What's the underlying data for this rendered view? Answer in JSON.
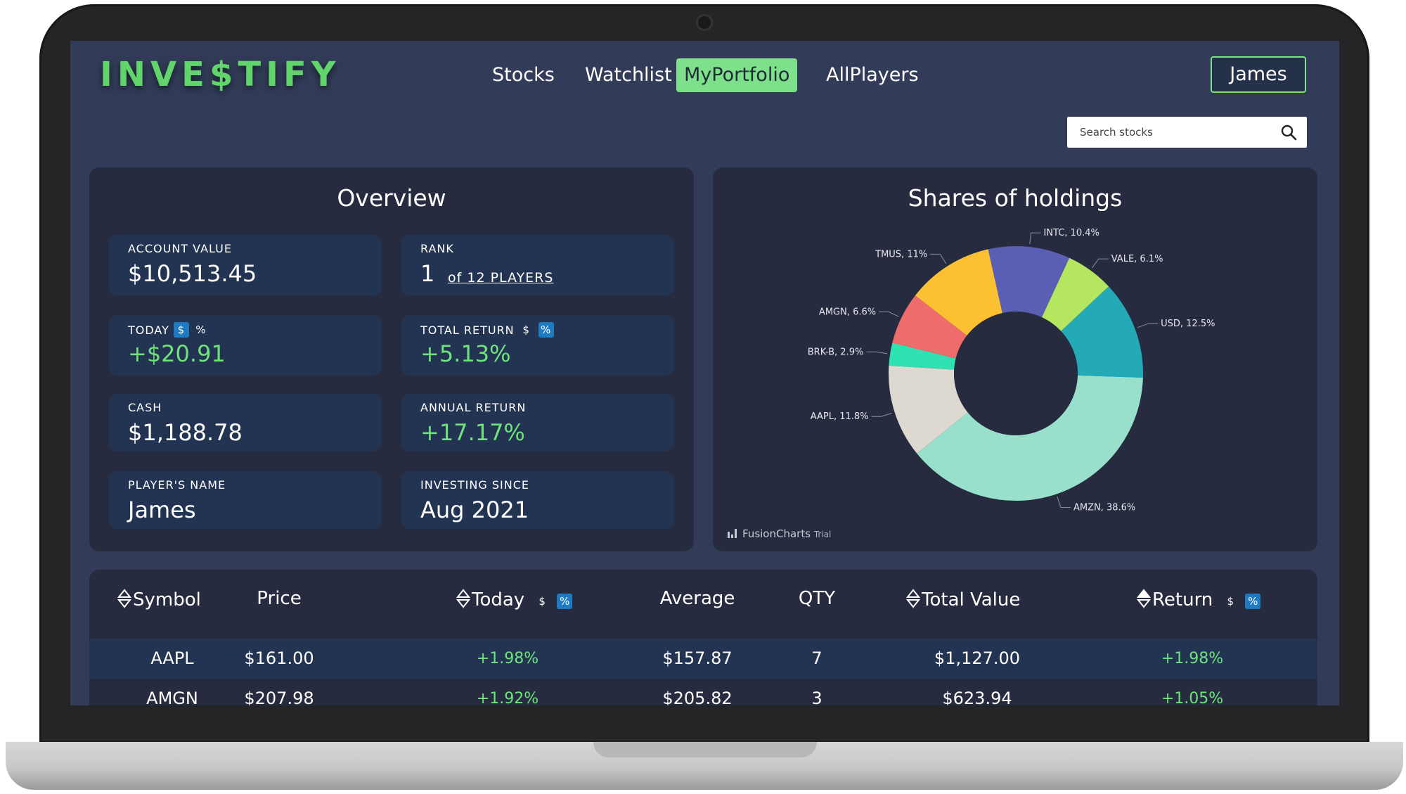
{
  "app": {
    "logo": "INVE$TIFY",
    "nav": [
      {
        "label": "Stocks",
        "active": false
      },
      {
        "label": "Watchlist",
        "active": false
      },
      {
        "label": "MyPortfolio",
        "active": true
      },
      {
        "label": "AllPlayers",
        "active": false
      }
    ],
    "user_button": "James",
    "search": {
      "placeholder": "Search stocks",
      "value": ""
    }
  },
  "overview": {
    "title": "Overview",
    "account_value": {
      "label": "ACCOUNT VALUE",
      "value": "$10,513.45"
    },
    "rank": {
      "label": "RANK",
      "value": "1",
      "of": "of 12 PLAYERS"
    },
    "today": {
      "label": "TODAY",
      "toggle_dollar": "$",
      "toggle_percent": "%",
      "active_toggle": "$",
      "value": "+$20.91"
    },
    "total_return": {
      "label": "TOTAL RETURN",
      "toggle_dollar": "$",
      "toggle_percent": "%",
      "active_toggle": "%",
      "value": "+5.13%"
    },
    "cash": {
      "label": "CASH",
      "value": "$1,188.78"
    },
    "annual_return": {
      "label": "ANNUAL RETURN",
      "value": "+17.17%"
    },
    "player_name": {
      "label": "PLAYER'S NAME",
      "value": "James"
    },
    "investing_since": {
      "label": "INVESTING SINCE",
      "value": "Aug 2021"
    }
  },
  "holdings_chart": {
    "credit": "FusionCharts",
    "credit_suffix": "Trial"
  },
  "chart_data": {
    "type": "pie",
    "variant": "doughnut",
    "title": "Shares of holdings",
    "slices": [
      {
        "label": "INTC, 10.4%",
        "value": 10.4,
        "color": "#5b5fb4"
      },
      {
        "label": "VALE, 6.1%",
        "value": 6.1,
        "color": "#b4e65f"
      },
      {
        "label": "USD, 12.5%",
        "value": 12.5,
        "color": "#24aab6"
      },
      {
        "label": "AMZN, 38.6%",
        "value": 38.6,
        "color": "#98dfcc"
      },
      {
        "label": "AAPL, 11.8%",
        "value": 11.8,
        "color": "#ddd8d0"
      },
      {
        "label": "BRK-B, 2.9%",
        "value": 2.9,
        "color": "#2ee3b1"
      },
      {
        "label": "AMGN, 6.6%",
        "value": 6.6,
        "color": "#ef6c6c"
      },
      {
        "label": "TMUS, 11%",
        "value": 11.0,
        "color": "#fcc133"
      }
    ]
  },
  "table": {
    "headers": {
      "symbol": "Symbol",
      "price": "Price",
      "today": "Today",
      "average": "Average",
      "qty": "QTY",
      "total_value": "Total Value",
      "return": "Return",
      "toggle_dollar": "$",
      "toggle_percent": "%"
    },
    "rows": [
      {
        "symbol": "AAPL",
        "price": "$161.00",
        "today": "+1.98%",
        "average": "$157.87",
        "qty": "7",
        "total_value": "$1,127.00",
        "return": "+1.98%"
      },
      {
        "symbol": "AMGN",
        "price": "$207.98",
        "today": "+1.92%",
        "average": "$205.82",
        "qty": "3",
        "total_value": "$623.94",
        "return": "+1.05%"
      }
    ]
  },
  "colors": {
    "accent_green": "#7ee08a",
    "positive": "#6fe27c",
    "toggle_blue": "#1e7bc2",
    "screen_bg": "#323c58",
    "card_bg": "#272b40",
    "stat_bg": "#233452"
  }
}
